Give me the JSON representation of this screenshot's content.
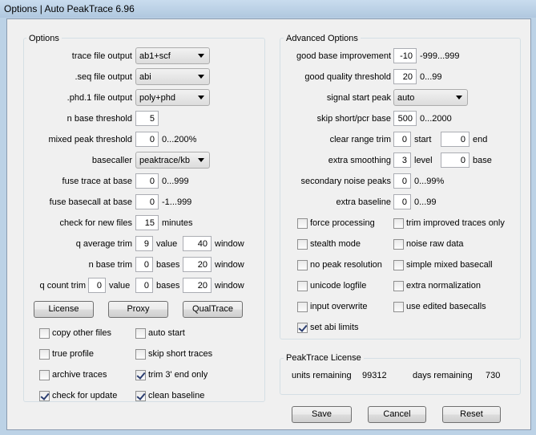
{
  "window": {
    "title": "Options | Auto PeakTrace 6.96"
  },
  "options": {
    "title": "Options",
    "trace_file_output": {
      "label": "trace file output",
      "value": "ab1+scf"
    },
    "seq_file_output": {
      "label": ".seq file output",
      "value": "abi"
    },
    "phd_file_output": {
      "label": ".phd.1 file output",
      "value": "poly+phd"
    },
    "n_base_threshold": {
      "label": "n base threshold",
      "value": "5"
    },
    "mixed_peak_threshold": {
      "label": "mixed peak threshold",
      "value": "0",
      "range": "0...200%"
    },
    "basecaller": {
      "label": "basecaller",
      "value": "peaktrace/kb"
    },
    "fuse_trace_at_base": {
      "label": "fuse trace at base",
      "value": "0",
      "range": "0...999"
    },
    "fuse_basecall_at_base": {
      "label": "fuse basecall at base",
      "value": "0",
      "range": "-1...999"
    },
    "check_new_files": {
      "label": "check for new files",
      "value": "15",
      "unit": "minutes"
    },
    "q_average_trim": {
      "label": "q average trim",
      "value": "9",
      "mid": "value",
      "window": "40",
      "window_label": "window"
    },
    "n_base_trim": {
      "label": "n base trim",
      "value": "0",
      "mid": "bases",
      "window": "20",
      "window_label": "window"
    },
    "q_count_trim": {
      "label": "q count trim",
      "value1": "0",
      "mid1": "value",
      "value2": "0",
      "mid2": "bases",
      "window": "20",
      "window_label": "window"
    },
    "buttons": {
      "license": "License",
      "proxy": "Proxy",
      "qualtrace": "QualTrace"
    },
    "checks": [
      {
        "label": "copy other files",
        "checked": false
      },
      {
        "label": "auto start",
        "checked": false
      },
      {
        "label": "true profile",
        "checked": false
      },
      {
        "label": "skip short traces",
        "checked": false
      },
      {
        "label": "archive traces",
        "checked": false
      },
      {
        "label": "trim 3' end only",
        "checked": true
      },
      {
        "label": "check for update",
        "checked": true
      },
      {
        "label": "clean baseline",
        "checked": true
      }
    ]
  },
  "advanced": {
    "title": "Advanced Options",
    "good_base_improvement": {
      "label": "good base improvement",
      "value": "-10",
      "range": "-999...999"
    },
    "good_quality_threshold": {
      "label": "good quality threshold",
      "value": "20",
      "range": "0...99"
    },
    "signal_start_peak": {
      "label": "signal start peak",
      "value": "auto"
    },
    "skip_short_pcr_base": {
      "label": "skip short/pcr base",
      "value": "500",
      "range": "0...2000"
    },
    "clear_range_trim": {
      "label": "clear range trim",
      "value1": "0",
      "mid": "start",
      "value2": "0",
      "end": "end"
    },
    "extra_smoothing": {
      "label": "extra smoothing",
      "value1": "3",
      "mid": "level",
      "value2": "0",
      "end": "base"
    },
    "secondary_noise_peaks": {
      "label": "secondary noise peaks",
      "value": "0",
      "range": "0...99%"
    },
    "extra_baseline": {
      "label": "extra baseline",
      "value": "0",
      "range": "0...99"
    },
    "checks": [
      {
        "label": "force processing",
        "checked": false
      },
      {
        "label": "trim improved traces only",
        "checked": false
      },
      {
        "label": "stealth mode",
        "checked": false
      },
      {
        "label": "noise raw data",
        "checked": false
      },
      {
        "label": "no peak resolution",
        "checked": false
      },
      {
        "label": "simple mixed basecall",
        "checked": false
      },
      {
        "label": "unicode logfile",
        "checked": false
      },
      {
        "label": "extra normalization",
        "checked": false
      },
      {
        "label": "input overwrite",
        "checked": false
      },
      {
        "label": "use edited basecalls",
        "checked": false
      },
      {
        "label": "set abi limits",
        "checked": true
      }
    ]
  },
  "license": {
    "title": "PeakTrace License",
    "units_label": "units remaining",
    "units_value": "99312",
    "days_label": "days remaining",
    "days_value": "730"
  },
  "footer": {
    "save": "Save",
    "cancel": "Cancel",
    "reset": "Reset"
  }
}
